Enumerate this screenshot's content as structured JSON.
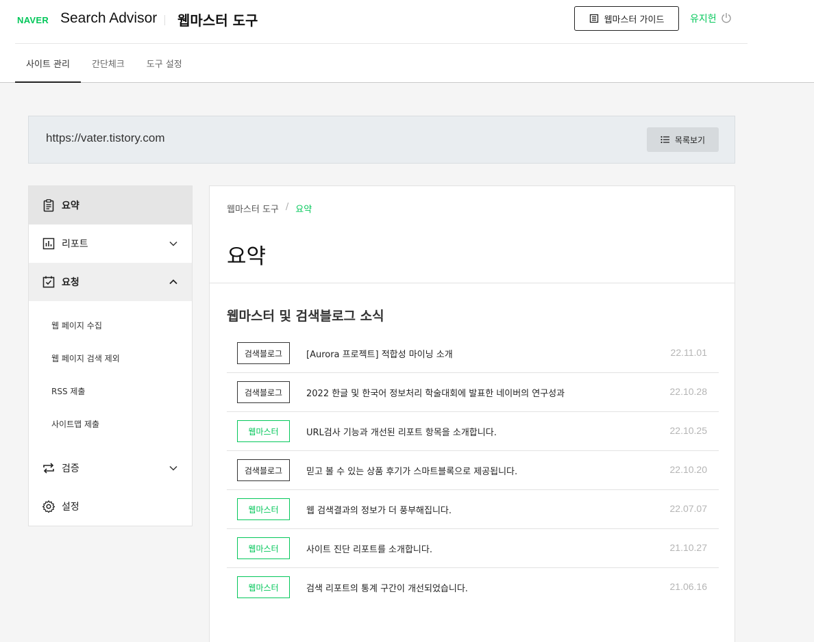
{
  "header": {
    "logo": "NAVER",
    "brand": "Search Advisor",
    "tool_title": "웹마스터 도구",
    "guide_button": "웹마스터 가이드",
    "user_name": "유지헌",
    "tabs": [
      {
        "label": "사이트 관리",
        "active": true
      },
      {
        "label": "간단체크",
        "active": false
      },
      {
        "label": "도구 설정",
        "active": false
      }
    ]
  },
  "site_bar": {
    "url": "https://vater.tistory.com",
    "list_button": "목록보기"
  },
  "sidebar": {
    "items": [
      {
        "label": "요약",
        "icon": "clipboard-icon",
        "state": "active"
      },
      {
        "label": "리포트",
        "icon": "bar-chart-icon",
        "state": "collapsed"
      },
      {
        "label": "요청",
        "icon": "checkbox-clipboard-icon",
        "state": "expanded"
      },
      {
        "label": "검증",
        "icon": "swap-arrows-icon",
        "state": "collapsed"
      },
      {
        "label": "설정",
        "icon": "gear-icon",
        "state": "none"
      }
    ],
    "request_subitems": [
      "웹 페이지 수집",
      "웹 페이지 검색 제외",
      "RSS 제출",
      "사이트맵 제출"
    ]
  },
  "main": {
    "breadcrumb": {
      "root": "웹마스터 도구",
      "separator": "/",
      "current": "요약"
    },
    "page_title": "요약",
    "section_title": "웹마스터 및 검색블로그 소식",
    "news": [
      {
        "category": "검색블로그",
        "title": "[Aurora 프로젝트] 적합성 마이닝 소개",
        "date": "22.11.01"
      },
      {
        "category": "검색블로그",
        "title": "2022 한글 및 한국어 정보처리 학술대회에 발표한 네이버의 연구성과",
        "date": "22.10.28"
      },
      {
        "category": "웹마스터",
        "title": "URL검사 기능과 개선된 리포트 항목을 소개합니다.",
        "date": "22.10.25"
      },
      {
        "category": "검색블로그",
        "title": "믿고 볼 수 있는 상품 후기가 스마트블록으로 제공됩니다.",
        "date": "22.10.20"
      },
      {
        "category": "웹마스터",
        "title": "웹 검색결과의 정보가 더 풍부해집니다.",
        "date": "22.07.07"
      },
      {
        "category": "웹마스터",
        "title": "사이트 진단 리포트를 소개합니다.",
        "date": "21.10.27"
      },
      {
        "category": "웹마스터",
        "title": "검색 리포트의 통계 구간이 개선되었습니다.",
        "date": "21.06.16"
      }
    ]
  },
  "colors": {
    "accent": "#03c75a",
    "site_bar_bg": "#e9edf0",
    "date": "#b5b5b5"
  }
}
